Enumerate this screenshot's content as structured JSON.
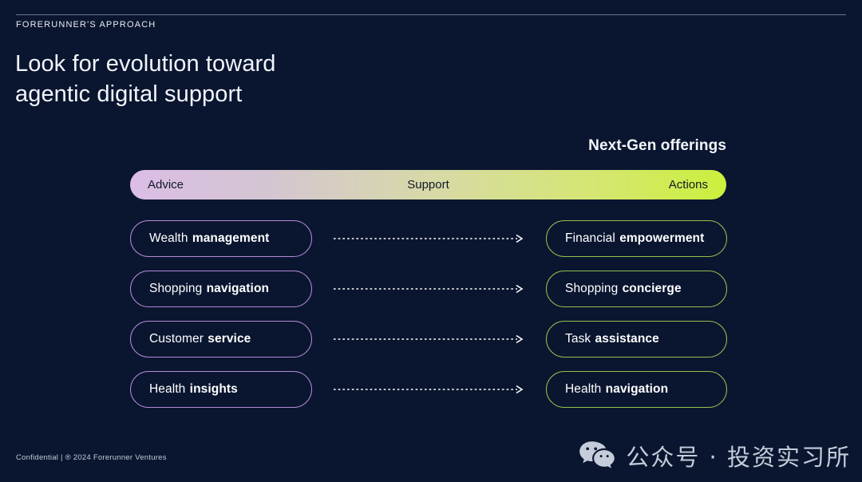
{
  "theme": {
    "background": "#0a1630",
    "text_primary": "#f2f5fa",
    "rule": "#7b88a8",
    "left_accent": "#b38ad4",
    "right_accent": "#93c14c",
    "gradient_start": "#dcbde6",
    "gradient_mid": "#d7d9a8",
    "gradient_end": "#cbf03c",
    "connector": "#ffffff"
  },
  "header": {
    "eyebrow": "FORERUNNER'S APPROACH",
    "title": "Look for evolution toward\nagentic digital support"
  },
  "diagram": {
    "column_label_right": "Next-Gen offerings",
    "spectrum": {
      "left_label": "Advice",
      "center_label": "Support",
      "right_label": "Actions"
    },
    "rows": [
      {
        "left": {
          "word1": "Wealth",
          "word2": "management"
        },
        "right": {
          "word1": "Financial",
          "word2": "empowerment"
        }
      },
      {
        "left": {
          "word1": "Shopping",
          "word2": "navigation"
        },
        "right": {
          "word1": "Shopping",
          "word2": "concierge"
        }
      },
      {
        "left": {
          "word1": "Customer",
          "word2": "service"
        },
        "right": {
          "word1": "Task",
          "word2": "assistance"
        }
      },
      {
        "left": {
          "word1": "Health",
          "word2": "insights"
        },
        "right": {
          "word1": "Health",
          "word2": "navigation"
        }
      }
    ]
  },
  "footer": {
    "confidential": "Confidential | ® 2024 Forerunner Ventures"
  },
  "watermark": {
    "icon": "wechat-icon",
    "text": "公众号 · 投资实习所"
  }
}
